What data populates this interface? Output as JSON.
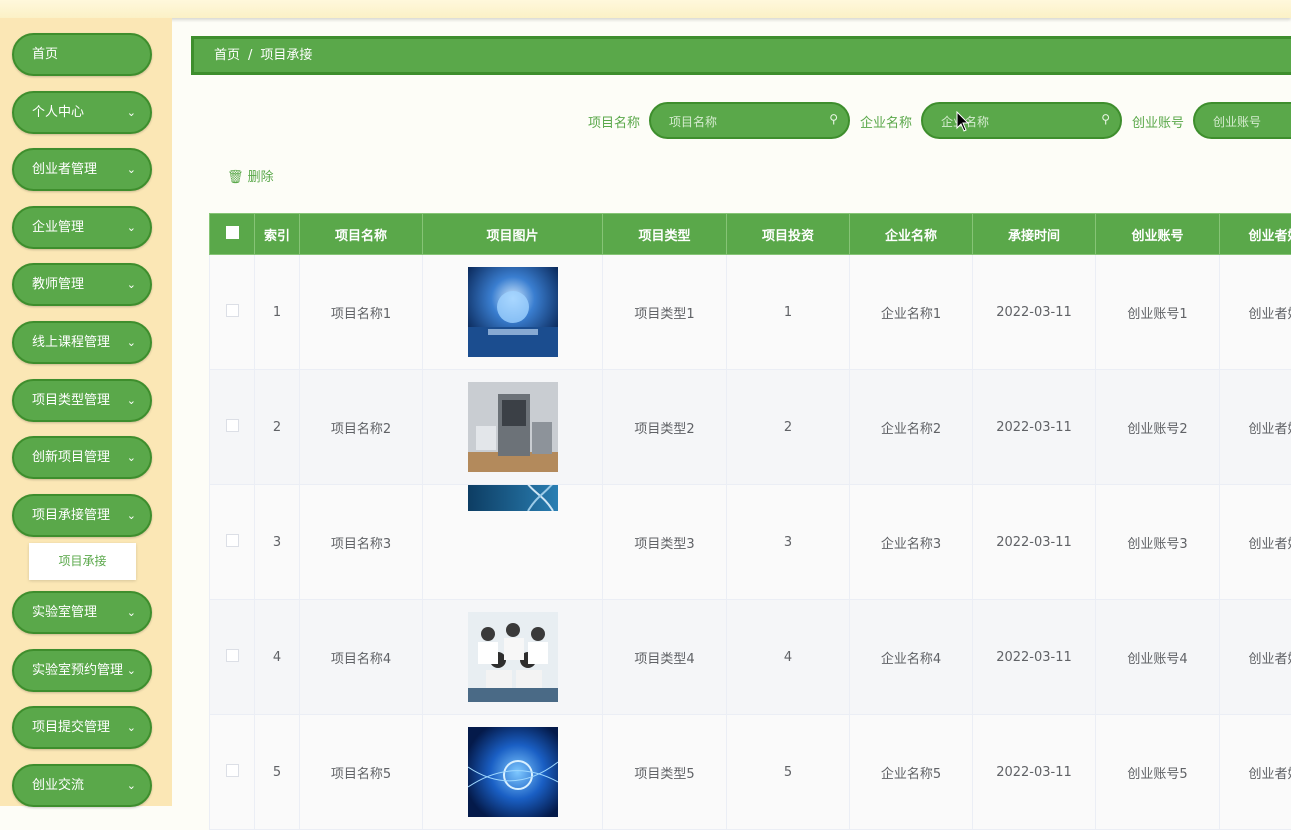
{
  "sidebar": {
    "items": [
      {
        "label": "首页",
        "has_children": false
      },
      {
        "label": "个人中心",
        "has_children": true
      },
      {
        "label": "创业者管理",
        "has_children": true
      },
      {
        "label": "企业管理",
        "has_children": true
      },
      {
        "label": "教师管理",
        "has_children": true
      },
      {
        "label": "线上课程管理",
        "has_children": true
      },
      {
        "label": "项目类型管理",
        "has_children": true
      },
      {
        "label": "创新项目管理",
        "has_children": true
      },
      {
        "label": "项目承接管理",
        "has_children": true
      },
      {
        "label": "实验室管理",
        "has_children": true
      },
      {
        "label": "实验室预约管理",
        "has_children": true
      },
      {
        "label": "项目提交管理",
        "has_children": true
      },
      {
        "label": "创业交流",
        "has_children": true
      }
    ],
    "submenu": {
      "label": "项目承接"
    },
    "chevron_icon": "chevron-down-icon"
  },
  "breadcrumb": {
    "home": "首页",
    "separator": "/",
    "current": "项目承接"
  },
  "search": {
    "project_name": {
      "label": "项目名称",
      "placeholder": "项目名称"
    },
    "company_name": {
      "label": "企业名称",
      "placeholder": "企业名称"
    },
    "account": {
      "label": "创业账号",
      "placeholder": "创业账号"
    }
  },
  "actions": {
    "delete_label": "删除",
    "delete_icon": "trash-icon"
  },
  "table": {
    "headers": [
      "索引",
      "项目名称",
      "项目图片",
      "项目类型",
      "项目投资",
      "企业名称",
      "承接时间",
      "创业账号",
      "创业者姓"
    ],
    "rows": [
      {
        "index": "1",
        "name": "项目名称1",
        "type": "项目类型1",
        "investment": "1",
        "company": "企业名称1",
        "time": "2022-03-11",
        "account": "创业账号1",
        "founder": "创业者姓"
      },
      {
        "index": "2",
        "name": "项目名称2",
        "type": "项目类型2",
        "investment": "2",
        "company": "企业名称2",
        "time": "2022-03-11",
        "account": "创业账号2",
        "founder": "创业者姓"
      },
      {
        "index": "3",
        "name": "项目名称3",
        "type": "项目类型3",
        "investment": "3",
        "company": "企业名称3",
        "time": "2022-03-11",
        "account": "创业账号3",
        "founder": "创业者姓"
      },
      {
        "index": "4",
        "name": "项目名称4",
        "type": "项目类型4",
        "investment": "4",
        "company": "企业名称4",
        "time": "2022-03-11",
        "account": "创业账号4",
        "founder": "创业者姓"
      },
      {
        "index": "5",
        "name": "项目名称5",
        "type": "项目类型5",
        "investment": "5",
        "company": "企业名称5",
        "time": "2022-03-11",
        "account": "创业账号5",
        "founder": "创业者姓"
      }
    ]
  },
  "colors": {
    "accent": "#5aa84a",
    "accent_dark": "#3e8e2d",
    "sidebar_bg": "#fbe7b5"
  }
}
